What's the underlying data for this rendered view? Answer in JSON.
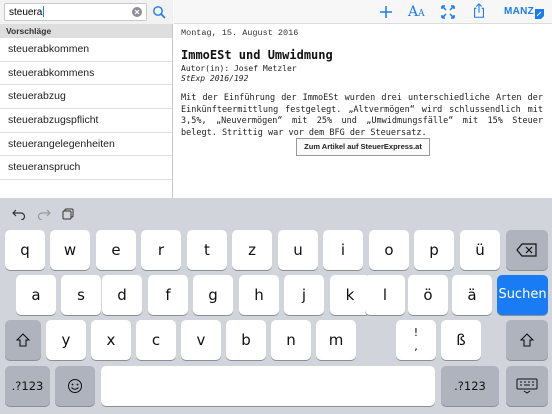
{
  "search": {
    "value": "steuera"
  },
  "suggestions": {
    "header": "Vorschläge",
    "items": [
      "steuerabkommen",
      "steuerabkommens",
      "steuerabzug",
      "steuerabzugspflicht",
      "steuerangelegenheiten",
      "steueranspruch"
    ]
  },
  "toolbar": {
    "brand": "MANZ",
    "font_label": "A",
    "font_label_small": "A",
    "accent": "#1a7cf5"
  },
  "article": {
    "date": "Montag, 15. August 2016",
    "title": "ImmoESt und Umwidmung",
    "author": "Autor(in): Josef Metzler",
    "source": "StExp 2016/192",
    "body": "Mit der Einführung der ImmoESt wurden drei unterschiedliche Arten der Einkünfteermittlung festgelegt. „Altvermögen“ wird schlussendlich mit 3,5%, „Neuvermögen“ mit 25% und „Umwidmungsfälle“ mit 15% Steuer belegt. Strittig war vor dem BFG der Steuersatz.",
    "link_label": "Zum Artikel auf SteuerExpress.at"
  },
  "keyboard": {
    "row1": [
      "q",
      "w",
      "e",
      "r",
      "t",
      "z",
      "u",
      "i",
      "o",
      "p",
      "ü"
    ],
    "row2": [
      "a",
      "s",
      "d",
      "f",
      "g",
      "h",
      "j",
      "k",
      "l",
      "ö",
      "ä"
    ],
    "row3": [
      "y",
      "x",
      "c",
      "v",
      "b",
      "n",
      "m",
      "ß"
    ],
    "search_label": "Suchen",
    "numbers_label": ".?123"
  }
}
